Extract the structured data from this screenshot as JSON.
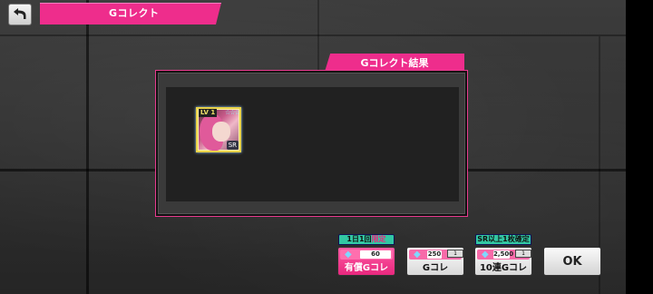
{
  "header": {
    "title": "Gコレクト",
    "back_icon": "back-arrow-icon"
  },
  "result": {
    "tab_label": "Gコレクト結果",
    "cards": [
      {
        "level_text": "LV 1",
        "stars_text": "☆☆☆",
        "rarity_text": "SR"
      }
    ]
  },
  "actions": [
    {
      "id": "paid",
      "tag_main": "1日1回",
      "tag_hi": "限定",
      "price": "60",
      "label": "有償Gコレ",
      "style": "pink"
    },
    {
      "id": "single",
      "tag_main": "",
      "tag_hi": "",
      "price": "250",
      "ticket": "1",
      "label": "Gコレ",
      "style": "white"
    },
    {
      "id": "ten",
      "tag_main": "SR以上1枚確定",
      "tag_hi": "",
      "price": "2,500",
      "ticket": "1",
      "label": "10連Gコレ",
      "style": "white"
    }
  ],
  "ok_label": "OK",
  "colors": {
    "accent_pink": "#ee2d8c",
    "tag_teal": "#32c7a3",
    "card_frame": "#e8d24a"
  }
}
